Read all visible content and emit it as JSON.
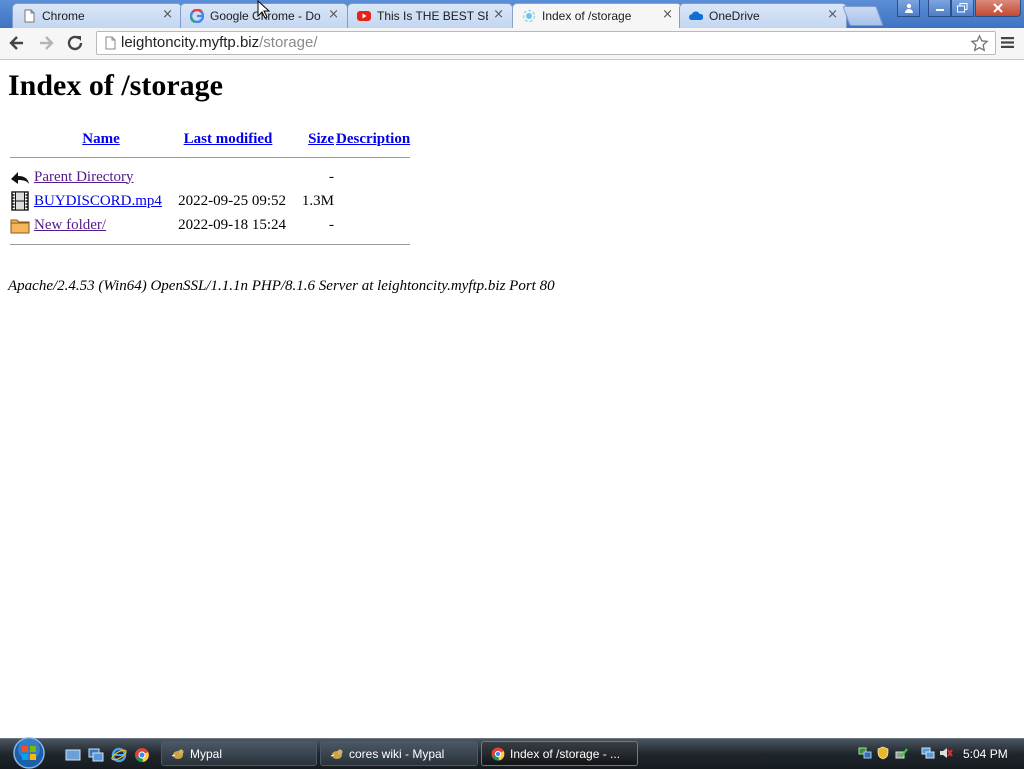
{
  "browser": {
    "tabs": [
      {
        "title": "Chrome",
        "favicon": "document-icon",
        "active": false
      },
      {
        "title": "Google Chrome - Do",
        "favicon": "google-icon",
        "active": false
      },
      {
        "title": "This Is THE BEST SEA",
        "favicon": "youtube-icon",
        "active": false
      },
      {
        "title": "Index of /storage",
        "favicon": "loading-icon",
        "active": true
      },
      {
        "title": "OneDrive",
        "favicon": "onedrive-icon",
        "active": false
      }
    ],
    "tab_close_glyph": "×",
    "window_controls": {
      "user": "user-icon",
      "minimize": "minimize-icon",
      "restore": "restore-icon",
      "close": "close-icon"
    },
    "address": {
      "host": "leightoncity.myftp.biz",
      "path": "/storage/"
    }
  },
  "page": {
    "heading": "Index of /storage",
    "columns": {
      "name": "Name",
      "last_modified": "Last modified",
      "size": "Size",
      "description": "Description"
    },
    "rows": [
      {
        "icon": "back-arrow-icon",
        "name": "Parent Directory",
        "modified": "",
        "size": "-",
        "description": ""
      },
      {
        "icon": "film-icon",
        "name": "BUYDISCORD.mp4",
        "modified": "2022-09-25 09:52",
        "size": "1.3M",
        "description": ""
      },
      {
        "icon": "folder-icon",
        "name": "New folder/",
        "modified": "2022-09-18 15:24",
        "size": "-",
        "description": ""
      }
    ],
    "server_signature": "Apache/2.4.53 (Win64) OpenSSL/1.1.1n PHP/8.1.6 Server at leightoncity.myftp.biz Port 80"
  },
  "taskbar": {
    "tasks": [
      {
        "label": "Mypal",
        "icon": "mypal-icon",
        "active": false
      },
      {
        "label": "cores wiki - Mypal",
        "icon": "mypal-icon",
        "active": false
      },
      {
        "label": "Index of /storage - ...",
        "icon": "chrome-icon",
        "active": true
      }
    ],
    "clock": "5:04 PM"
  },
  "colors": {
    "link": "#0000ee",
    "visited_link": "#551a8b",
    "titlebar": "#3f73c2",
    "taskbar": "#1f262c"
  }
}
